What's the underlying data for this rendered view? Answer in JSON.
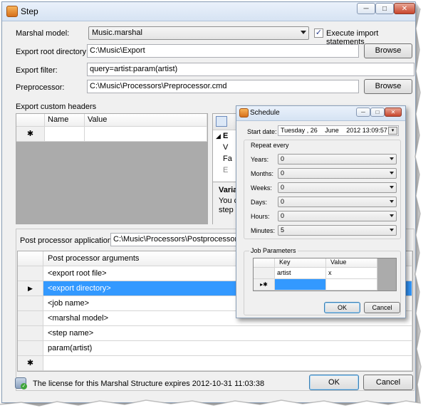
{
  "window": {
    "title": "Step",
    "minimize_glyph": "─",
    "maximize_glyph": "□",
    "close_glyph": "✕"
  },
  "form": {
    "marshal_model_label": "Marshal model:",
    "marshal_model_value": "Music.marshal",
    "execute_import_label": "Execute import statements",
    "execute_import_checked": "✓",
    "export_root_label": "Export root directory:",
    "export_root_value": "C:\\Music\\Export",
    "browse_label": "Browse",
    "export_filter_label": "Export filter:",
    "export_filter_value": "query=artist:param(artist)",
    "preprocessor_label": "Preprocessor:",
    "preprocessor_value": "C:\\Music\\Processors\\Preprocessor.cmd",
    "custom_headers_label": "Export custom headers"
  },
  "headers_grid": {
    "columns": [
      "Name",
      "Value"
    ],
    "new_row_marker": "✱"
  },
  "property_panel": {
    "section_letter": "E",
    "lines": [
      "V",
      "Fa",
      "E"
    ],
    "desc_title": "Varia",
    "desc_lines": [
      "You c",
      "step n"
    ]
  },
  "post_processor": {
    "label": "Post processor application:",
    "value": "C:\\Music\\Processors\\Postprocessor.c",
    "args_header": "Post processor arguments",
    "current_row_marker": "▶",
    "new_row_marker": "✱",
    "rows": [
      "<export root file>",
      "<export directory>",
      "<job name>",
      "<marshal model>",
      "<step name>",
      "param(artist)"
    ]
  },
  "footer": {
    "license_text": "The license for this Marshal Structure expires 2012-10-31 11:03:38",
    "ok_label": "OK",
    "cancel_label": "Cancel"
  },
  "schedule": {
    "title": "Schedule",
    "start_date_label": "Start date:",
    "start_date_day": "Tuesday",
    "start_date_date": ", 26",
    "start_date_month": "June",
    "start_date_rest": "2012 13:09:57",
    "repeat_label": "Repeat every",
    "fields": [
      {
        "label": "Years:",
        "value": "0"
      },
      {
        "label": "Months:",
        "value": "0"
      },
      {
        "label": "Weeks:",
        "value": "0"
      },
      {
        "label": "Days:",
        "value": "0"
      },
      {
        "label": "Hours:",
        "value": "0"
      },
      {
        "label": "Minutes:",
        "value": "5"
      }
    ],
    "job_params_label": "Job Parameters",
    "param_columns": [
      "Key",
      "Value"
    ],
    "param_rows": [
      {
        "key": "artist",
        "value": "x"
      }
    ],
    "current_new_marker": "▸✱",
    "ok_label": "OK",
    "cancel_label": "Cancel"
  },
  "colors": {
    "selection": "#3399ff",
    "title_gradient": "#d6e3f3"
  }
}
